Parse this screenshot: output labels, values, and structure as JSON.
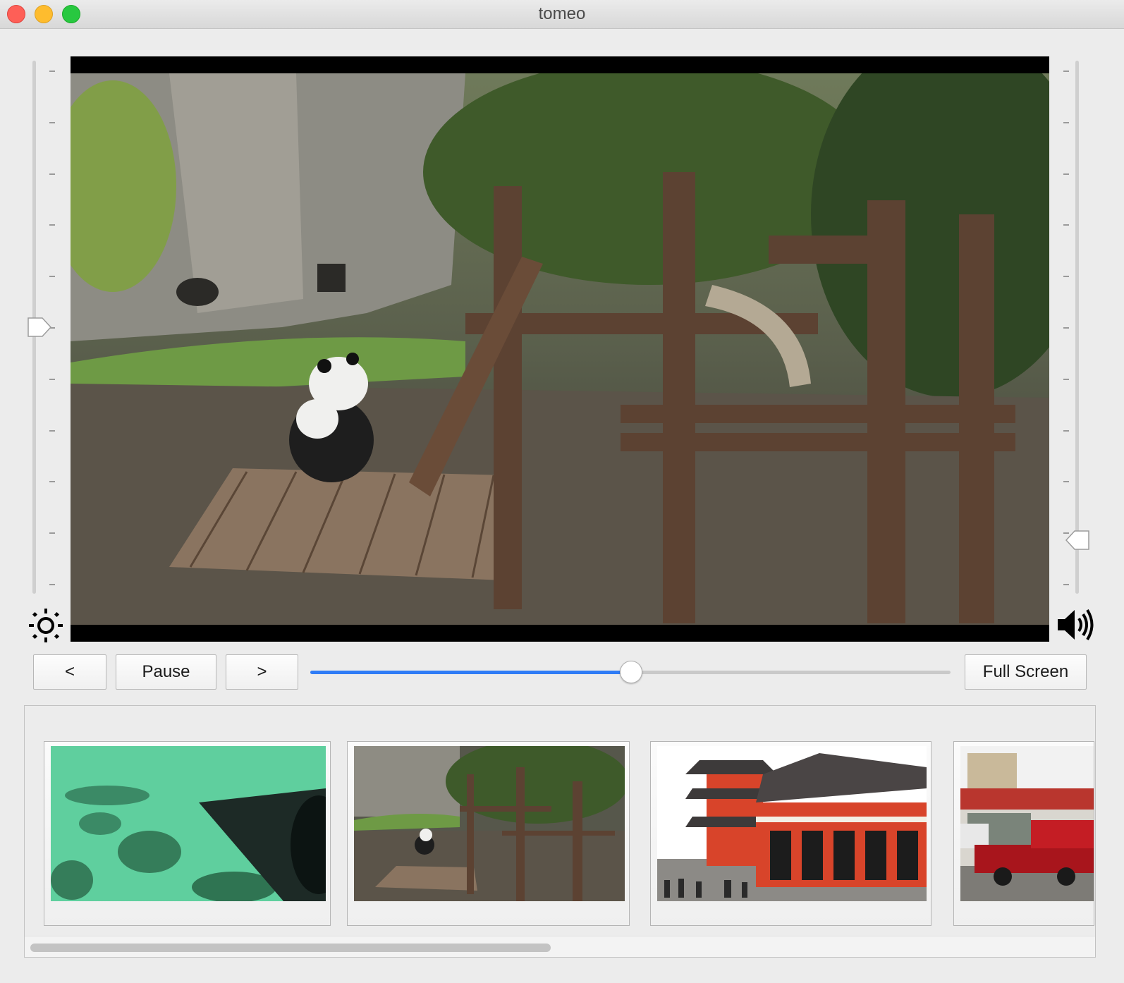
{
  "window": {
    "title": "tomeo"
  },
  "video": {
    "description_icon": "video-frame"
  },
  "brightness": {
    "icon": "brightness-icon",
    "level": 0.5
  },
  "volume": {
    "icon": "speaker-volume-icon",
    "level": 0.1
  },
  "controls": {
    "prev_label": "<",
    "pause_label": "Pause",
    "next_label": ">",
    "fullscreen_label": "Full Screen",
    "progress": 0.5
  },
  "thumbnails": [
    {
      "scene": "underwater"
    },
    {
      "scene": "panda-enclosure"
    },
    {
      "scene": "red-temple"
    },
    {
      "scene": "street-truck"
    }
  ],
  "colors": {
    "accent": "#2f7cf6"
  }
}
